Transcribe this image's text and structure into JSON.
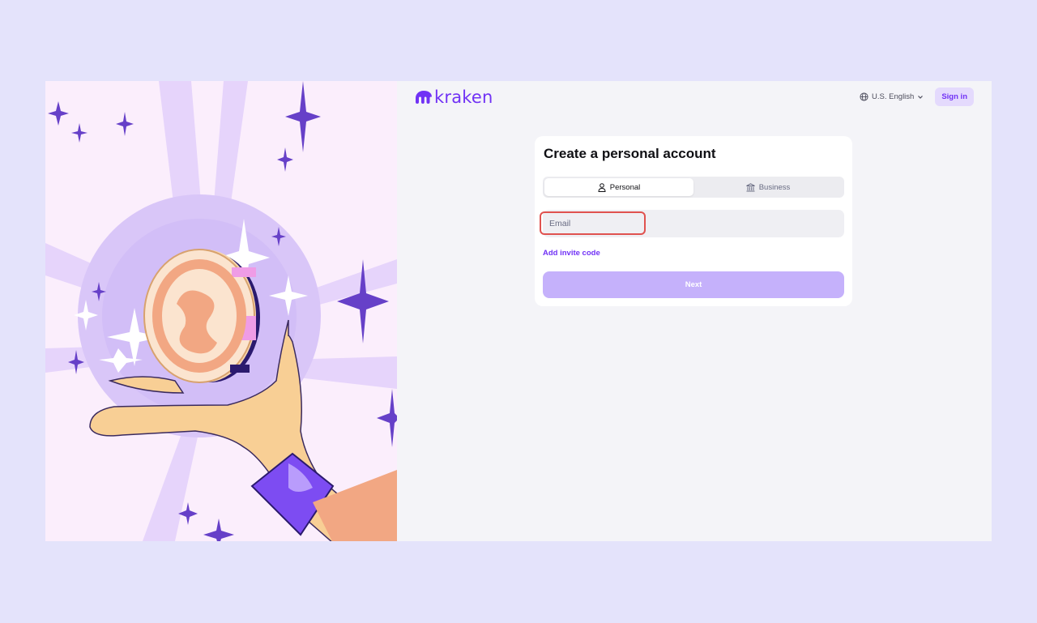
{
  "header": {
    "logo_text": "kraken",
    "language": "U.S. English",
    "signin_label": "Sign in"
  },
  "form": {
    "title": "Create a personal account",
    "tabs": [
      {
        "label": "Personal",
        "icon": "person-icon",
        "active": true
      },
      {
        "label": "Business",
        "icon": "bank-icon",
        "active": false
      }
    ],
    "email_placeholder": "Email",
    "invite_label": "Add invite code",
    "next_label": "Next"
  },
  "colors": {
    "brand": "#7132f5",
    "button_disabled": "#c5b1fb",
    "highlight": "#e0524f",
    "page_bg": "#e4e3fb"
  }
}
